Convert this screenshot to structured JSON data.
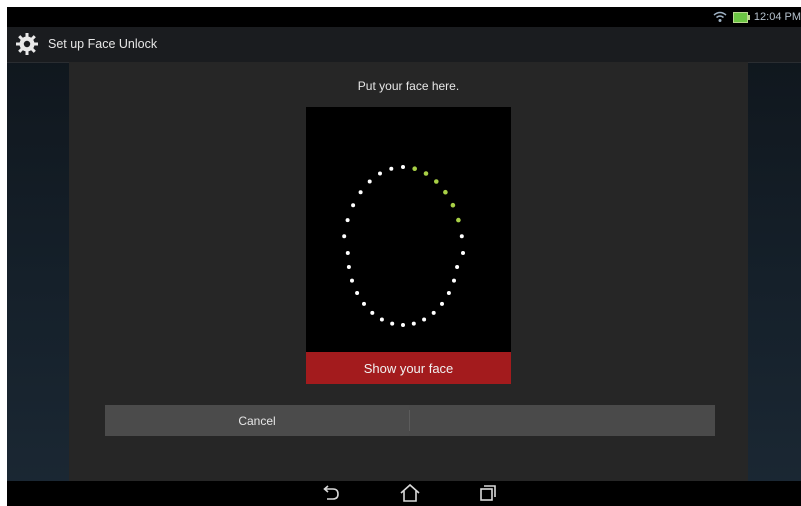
{
  "status_bar": {
    "time": "12:04 PM",
    "wifi_icon": "wifi-icon",
    "battery_icon": "battery-charging-icon"
  },
  "action_bar": {
    "title": "Set up Face Unlock",
    "icon": "gear-icon"
  },
  "dialog": {
    "instruction": "Put your face here.",
    "show_face_label": "Show your face",
    "cancel_label": "Cancel"
  },
  "colors": {
    "accent_red": "#a31b1d",
    "dot_white": "#ffffff",
    "dot_green": "#a8d046",
    "dialog_bg": "#262626"
  },
  "navigation": {
    "back_icon": "back-icon",
    "home_icon": "home-icon",
    "recents_icon": "recents-icon"
  }
}
